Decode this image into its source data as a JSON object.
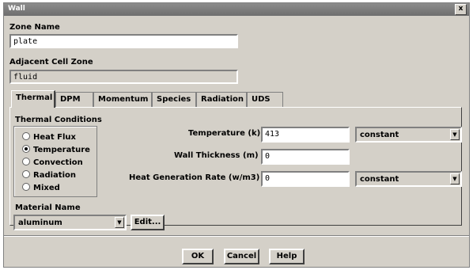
{
  "window": {
    "title": "Wall",
    "close_glyph": "x"
  },
  "zone_name": {
    "label": "Zone Name",
    "value": "plate"
  },
  "adjacent_cell_zone": {
    "label": "Adjacent Cell Zone",
    "value": "fluid"
  },
  "tabs": [
    {
      "label": "Thermal",
      "active": true
    },
    {
      "label": "DPM",
      "active": false
    },
    {
      "label": "Momentum",
      "active": false
    },
    {
      "label": "Species",
      "active": false
    },
    {
      "label": "Radiation",
      "active": false
    },
    {
      "label": "UDS",
      "active": false
    }
  ],
  "thermal_conditions": {
    "label": "Thermal Conditions",
    "options": [
      {
        "label": "Heat Flux",
        "selected": false
      },
      {
        "label": "Temperature",
        "selected": true
      },
      {
        "label": "Convection",
        "selected": false
      },
      {
        "label": "Radiation",
        "selected": false
      },
      {
        "label": "Mixed",
        "selected": false
      }
    ]
  },
  "temperature": {
    "label": "Temperature (k)",
    "value": "413",
    "method": "constant"
  },
  "wall_thickness": {
    "label": "Wall Thickness (m)",
    "value": "0"
  },
  "heat_generation": {
    "label": "Heat Generation Rate (w/m3)",
    "value": "0",
    "method": "constant"
  },
  "material": {
    "label": "Material Name",
    "value": "aluminum",
    "edit_label": "Edit..."
  },
  "buttons": {
    "ok": "OK",
    "cancel": "Cancel",
    "help": "Help"
  }
}
